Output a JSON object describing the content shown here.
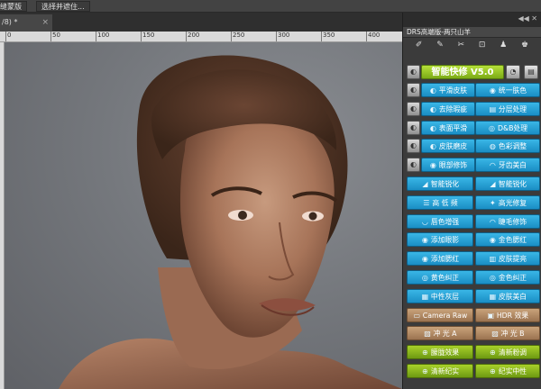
{
  "optbar": {
    "btn1": "缝蒙版",
    "btn2": "选择并遮住..."
  },
  "doc_tab": {
    "label": "/8) *",
    "close": "×"
  },
  "ruler": {
    "numbers": [
      "0",
      "50",
      "100",
      "150",
      "200",
      "250",
      "300",
      "350",
      "400"
    ]
  },
  "panel": {
    "arrows": "◀◀  ✕",
    "title": "DRS高端版-两只山羊",
    "tools": [
      "✐",
      "✎",
      "✂",
      "⊡",
      "♟",
      "♚"
    ],
    "headline": "智能快修 V5.0",
    "rows": [
      {
        "left": "平滑皮肤",
        "right": "统一肤色",
        "left_icon": "◐",
        "right_icon": "◉"
      },
      {
        "left": "去除瑕疵",
        "right": "分层处理",
        "left_icon": "◐",
        "right_icon": "▤"
      },
      {
        "left": "表面平滑",
        "right": "D&B处理",
        "left_icon": "◐",
        "right_icon": "◎"
      },
      {
        "left": "皮肤磨皮",
        "right": "色彩调整",
        "left_icon": "◐",
        "right_icon": "◍"
      },
      {
        "left": "眼部修饰",
        "right": "牙齿美白",
        "left_icon": "◉",
        "right_icon": "◠"
      },
      {
        "left": "智能锐化",
        "right": "智能锐化",
        "left_icon": "◢",
        "right_icon": "◢"
      },
      {
        "left": "高 低 频",
        "right": "高光修复",
        "left_icon": "☰",
        "right_icon": "✦"
      },
      {
        "left": "唇色增强",
        "right": "睫毛修饰",
        "left_icon": "◡",
        "right_icon": "◠"
      },
      {
        "left": "添加眼影",
        "right": "金色腮红",
        "left_icon": "◉",
        "right_icon": "◉"
      },
      {
        "left": "添加腮红",
        "right": "皮肤提亮",
        "left_icon": "◉",
        "right_icon": "▥"
      },
      {
        "left": "黄色纠正",
        "right": "金色纠正",
        "left_icon": "◎",
        "right_icon": "◎"
      },
      {
        "left": "中性灰层",
        "right": "皮肤美白",
        "left_icon": "▦",
        "right_icon": "▦"
      },
      {
        "left": "Camera Raw",
        "right": "HDR 效果",
        "left_icon": "▭",
        "right_icon": "▣",
        "style": "brown"
      },
      {
        "left": "冲 光 A",
        "right": "冲 光 B",
        "left_icon": "▨",
        "right_icon": "▨",
        "style": "brown"
      },
      {
        "left": "朦胧效果",
        "right": "清新粉调",
        "left_icon": "⊕",
        "right_icon": "⊕",
        "style": "green"
      },
      {
        "left": "清新纪实",
        "right": "纪实中性",
        "left_icon": "⊕",
        "right_icon": "⊕",
        "style": "green"
      }
    ]
  }
}
